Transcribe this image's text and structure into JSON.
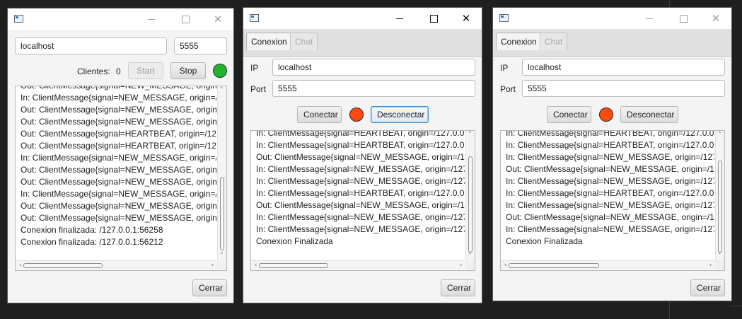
{
  "colors": {
    "status_green": "#22b52b",
    "status_red": "#ff4a0d"
  },
  "server_window": {
    "title_icon": "app-window-icon",
    "host": "localhost",
    "port": "5555",
    "clients_label": "Clientes:",
    "clients_count": "0",
    "start_label": "Start",
    "stop_label": "Stop",
    "status_color": "green",
    "log": [
      "Out: ClientMessage{signal=NEW_MESSAGE, origin=/",
      "In: ClientMessage{signal=NEW_MESSAGE, origin=/12",
      "Out: ClientMessage{signal=NEW_MESSAGE, origin=/",
      "Out: ClientMessage{signal=NEW_MESSAGE, origin=/",
      "Out: ClientMessage{signal=HEARTBEAT, origin=/127",
      "Out: ClientMessage{signal=HEARTBEAT, origin=/127",
      "In: ClientMessage{signal=NEW_MESSAGE, origin=/12",
      "Out: ClientMessage{signal=NEW_MESSAGE, origin=/",
      "Out: ClientMessage{signal=NEW_MESSAGE, origin=/",
      "In: ClientMessage{signal=NEW_MESSAGE, origin=/12",
      "Out: ClientMessage{signal=NEW_MESSAGE, origin=/",
      "Out: ClientMessage{signal=NEW_MESSAGE, origin=/",
      "Conexion finalizada: /127.0.0.1:56258",
      "Conexion finalizada: /127.0.0.1:56212"
    ],
    "close_label": "Cerrar"
  },
  "client_window_1": {
    "tabs": [
      "Conexion",
      "Chat"
    ],
    "ip_label": "IP",
    "ip_value": "localhost",
    "port_label": "Port",
    "port_value": "5555",
    "connect_label": "Conectar",
    "disconnect_label": "Desconectar",
    "status_color": "red",
    "log": [
      "In: ClientMessage{signal=HEARTBEAT, origin=/127.0.0.1:",
      "In: ClientMessage{signal=HEARTBEAT, origin=/127.0.0.1:",
      "Out: ClientMessage{signal=NEW_MESSAGE, origin=/127",
      "In: ClientMessage{signal=NEW_MESSAGE, origin=/127.0",
      "In: ClientMessage{signal=NEW_MESSAGE, origin=/127.0",
      "In: ClientMessage{signal=HEARTBEAT, origin=/127.0.0.1:",
      "Out: ClientMessage{signal=NEW_MESSAGE, origin=/127",
      "In: ClientMessage{signal=NEW_MESSAGE, origin=/127.0",
      "In: ClientMessage{signal=NEW_MESSAGE, origin=/127.0",
      "Conexion Finalizada"
    ],
    "close_label": "Cerrar"
  },
  "client_window_2": {
    "tabs": [
      "Conexion",
      "Chat"
    ],
    "ip_label": "IP",
    "ip_value": "localhost",
    "port_label": "Port",
    "port_value": "5555",
    "connect_label": "Conectar",
    "disconnect_label": "Desconectar",
    "status_color": "red",
    "log": [
      "In: ClientMessage{signal=HEARTBEAT, origin=/127.0.0.1:",
      "In: ClientMessage{signal=HEARTBEAT, origin=/127.0.0.1:",
      "In: ClientMessage{signal=NEW_MESSAGE, origin=/127.0",
      "Out: ClientMessage{signal=NEW_MESSAGE, origin=/127",
      "In: ClientMessage{signal=NEW_MESSAGE, origin=/127.0",
      "In: ClientMessage{signal=HEARTBEAT, origin=/127.0.0.1:",
      "In: ClientMessage{signal=NEW_MESSAGE, origin=/127.0",
      "Out: ClientMessage{signal=NEW_MESSAGE, origin=/127",
      "In: ClientMessage{signal=NEW_MESSAGE, origin=/127.0",
      "Conexion Finalizada"
    ],
    "close_label": "Cerrar"
  }
}
